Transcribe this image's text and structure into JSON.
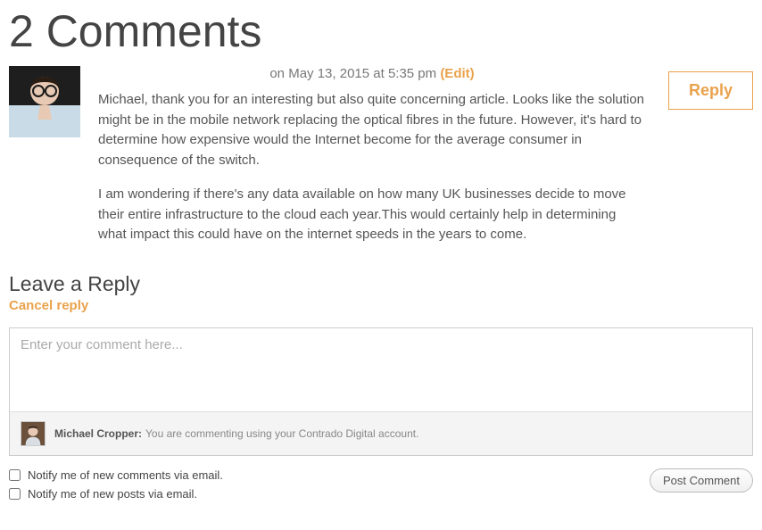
{
  "title": "2 Comments",
  "comment": {
    "meta_prefix": "on ",
    "date": "May 13, 2015 at 5:35 pm",
    "edit_label": "(Edit)",
    "reply_label": "Reply",
    "para1": "Michael, thank you for an interesting but also quite concerning article. Looks like the solution might be in the mobile network replacing the optical fibres in the future. However, it's hard to determine how expensive would the Internet become for the average consumer in consequence of the switch.",
    "para2": "I am wondering if there's any data available on how many UK businesses decide to move their entire infrastructure to the cloud each year.This would certainly help in determining what impact this could have on the internet speeds in the years to come."
  },
  "reply_form": {
    "heading": "Leave a Reply",
    "cancel_label": "Cancel reply",
    "placeholder": "Enter your comment here...",
    "identity_user": "Michael Cropper:",
    "identity_text": " You are commenting using your Contrado Digital account.",
    "notify_comments": "Notify me of new comments via email.",
    "notify_posts": "Notify me of new posts via email.",
    "post_label": "Post Comment"
  }
}
